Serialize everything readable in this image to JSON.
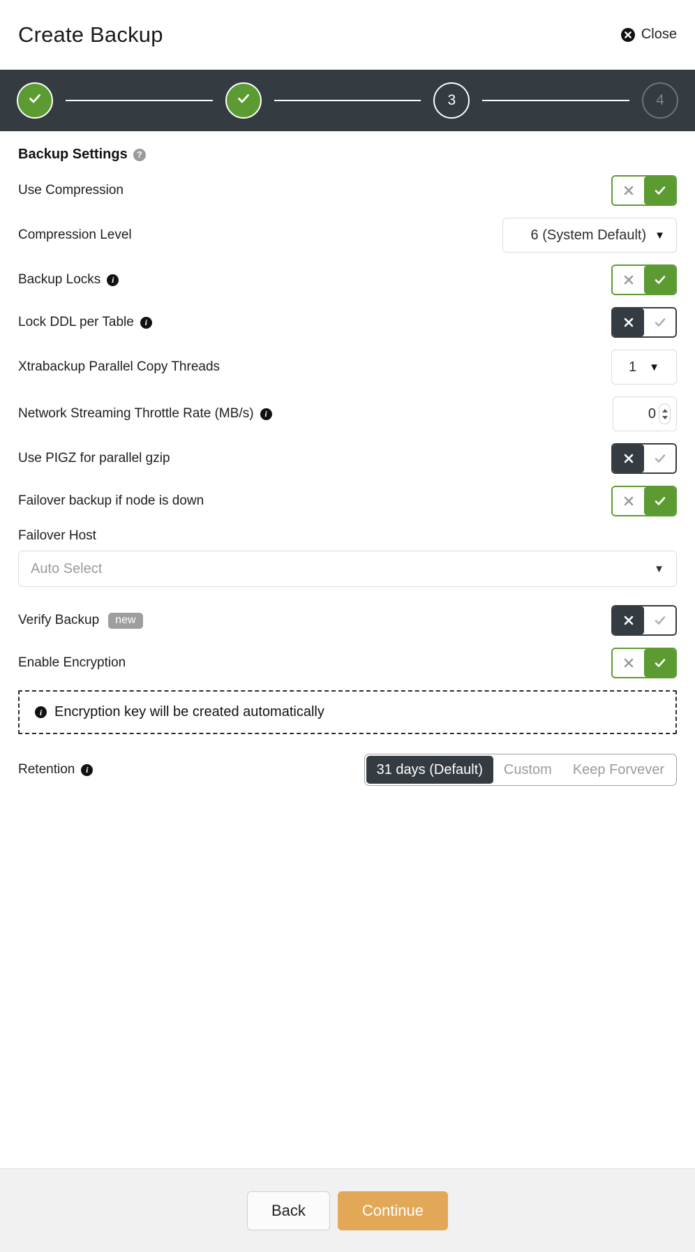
{
  "header": {
    "title": "Create Backup",
    "close_label": "Close",
    "close_icon": "close-circle-x-icon"
  },
  "stepper": {
    "steps": [
      {
        "label": "1",
        "state": "done",
        "glyph": "check"
      },
      {
        "label": "2",
        "state": "done",
        "glyph": "check"
      },
      {
        "label": "3",
        "state": "current",
        "glyph": "3"
      },
      {
        "label": "4",
        "state": "pending",
        "glyph": "4"
      }
    ]
  },
  "settings": {
    "section_title": "Backup Settings",
    "section_help_icon": "question-mark-icon",
    "rows": {
      "use_compression": {
        "label": "Use Compression",
        "state": "on",
        "x_glyph": "✕",
        "check_glyph": "✓"
      },
      "compression_level": {
        "label": "Compression Level",
        "value": "6 (System Default)",
        "caret": "▼"
      },
      "backup_locks": {
        "label": "Backup Locks",
        "info_icon": "info-icon",
        "state": "on"
      },
      "lock_ddl_per_table": {
        "label": "Lock DDL per Table",
        "info_icon": "info-icon",
        "state": "off"
      },
      "xtrabackup_threads": {
        "label": "Xtrabackup Parallel Copy Threads",
        "value": "1",
        "caret": "▼"
      },
      "network_throttle": {
        "label": "Network Streaming Throttle Rate (MB/s)",
        "info_icon": "info-icon",
        "value": "0"
      },
      "use_pigz": {
        "label": "Use PIGZ for parallel gzip",
        "state": "off"
      },
      "failover_backup": {
        "label": "Failover backup if node is down",
        "state": "on"
      },
      "failover_host": {
        "label": "Failover Host",
        "value": "Auto Select",
        "caret": "▼"
      },
      "verify_backup": {
        "label": "Verify Backup",
        "badge": "new",
        "state": "off"
      },
      "enable_encryption": {
        "label": "Enable Encryption",
        "state": "on"
      }
    },
    "encryption_notice": {
      "icon": "info-icon",
      "text": "Encryption key will be created automatically"
    },
    "retention": {
      "label": "Retention",
      "info_icon": "info-icon",
      "options": [
        {
          "label": "31 days (Default)",
          "active": true
        },
        {
          "label": "Custom",
          "active": false
        },
        {
          "label": "Keep Forvever",
          "active": false
        }
      ]
    }
  },
  "footer": {
    "back_label": "Back",
    "continue_label": "Continue"
  },
  "colors": {
    "accent_green": "#5c9b31",
    "dark": "#343b41",
    "continue_orange": "#e3a857",
    "badge_gray": "#9e9e9e"
  }
}
